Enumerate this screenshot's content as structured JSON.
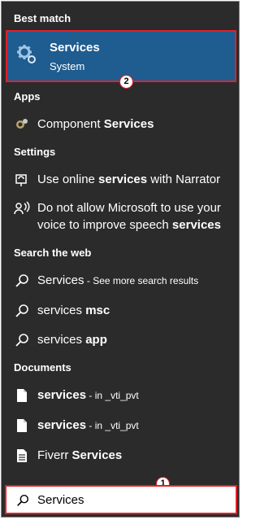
{
  "sections": {
    "best_match": "Best match",
    "apps": "Apps",
    "settings": "Settings",
    "search_web": "Search the web",
    "documents": "Documents"
  },
  "best_match": {
    "title": "Services",
    "subtitle": "System",
    "icon": "gear-icon"
  },
  "badges": {
    "b1": "1",
    "b2": "2"
  },
  "apps": [
    {
      "pre": "Component ",
      "bold": "Services",
      "icon": "component-services-icon"
    }
  ],
  "settings": [
    {
      "pre": "Use online ",
      "bold": "services",
      "post": " with Narrator",
      "icon": "narrator-icon"
    },
    {
      "line1": "Do not allow Microsoft to use your",
      "line2_pre": "voice to improve speech ",
      "line2_bold": "services",
      "icon": "voice-icon"
    }
  ],
  "web": [
    {
      "pre": "Services",
      "small": " - See more search results",
      "icon": "search-icon"
    },
    {
      "pre": "services ",
      "bold": "msc",
      "icon": "search-icon"
    },
    {
      "pre": "services ",
      "bold": "app",
      "icon": "search-icon"
    }
  ],
  "documents": [
    {
      "bold": "services",
      "small": " - in _vti_pvt",
      "icon": "document-icon"
    },
    {
      "bold": "services",
      "small": " - in _vti_pvt",
      "icon": "document-icon"
    },
    {
      "pre": "Fiverr ",
      "bold": "Services",
      "icon": "document-icon"
    }
  ],
  "search_box": {
    "value": "Services",
    "icon": "search-icon"
  },
  "colors": {
    "panel": "#2b2b2b",
    "selected": "#1f5c8f",
    "highlight": "#e0212b"
  }
}
